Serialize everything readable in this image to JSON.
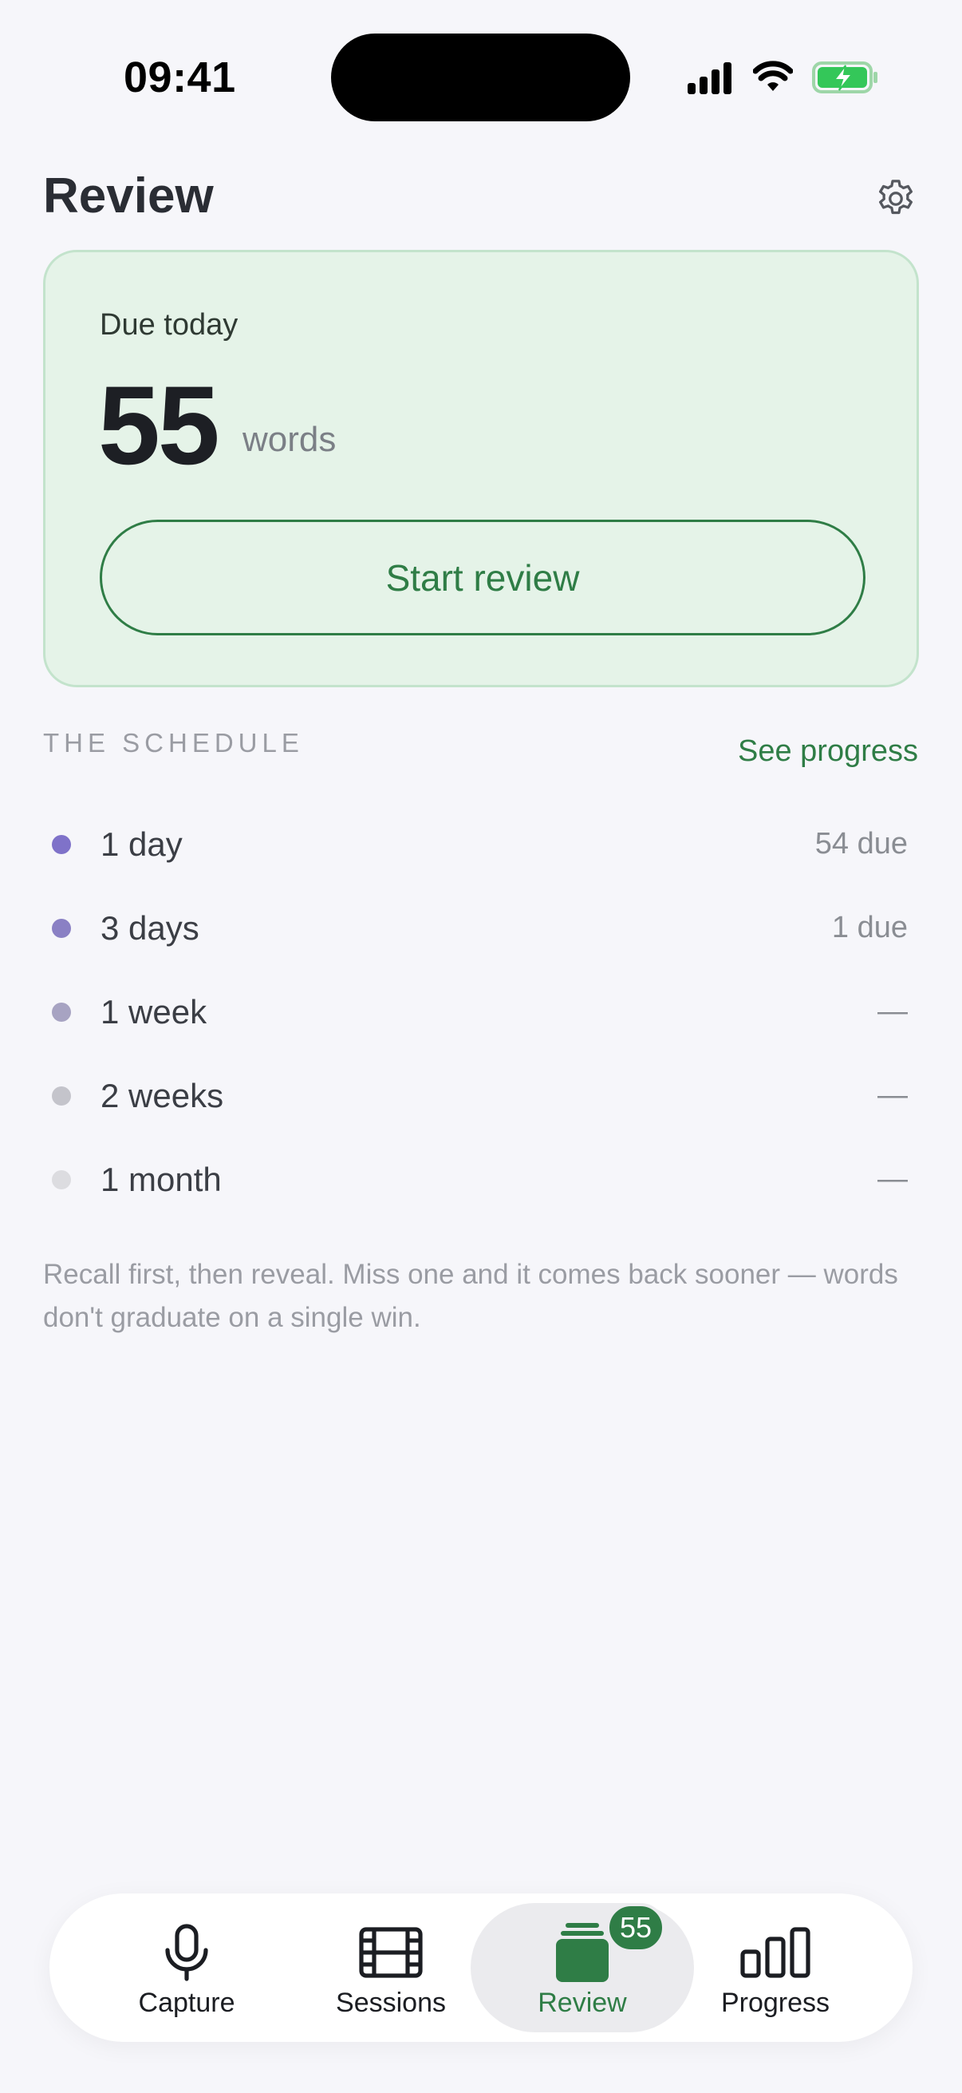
{
  "status_bar": {
    "time": "09:41"
  },
  "header": {
    "title": "Review"
  },
  "due_card": {
    "label": "Due today",
    "count": "55",
    "unit": "words",
    "button_label": "Start review"
  },
  "schedule": {
    "section_label": "THE SCHEDULE",
    "link_label": "See progress",
    "rows": [
      {
        "label": "1 day",
        "value": "54 due",
        "dot_color": "#7f72c9"
      },
      {
        "label": "3 days",
        "value": "1 due",
        "dot_color": "#8a80c4"
      },
      {
        "label": "1 week",
        "value": "—",
        "dot_color": "#a7a3c2"
      },
      {
        "label": "2 weeks",
        "value": "—",
        "dot_color": "#c4c4cb"
      },
      {
        "label": "1 month",
        "value": "—",
        "dot_color": "#dcdce0"
      }
    ]
  },
  "hint": "Recall first, then reveal. Miss one and it comes back sooner — words don't graduate on a single win.",
  "tabbar": {
    "tabs": [
      {
        "label": "Capture",
        "icon": "microphone-icon"
      },
      {
        "label": "Sessions",
        "icon": "film-icon"
      },
      {
        "label": "Review",
        "icon": "cards-stack-icon",
        "badge": "55",
        "active": true
      },
      {
        "label": "Progress",
        "icon": "bar-chart-icon"
      }
    ]
  },
  "colors": {
    "accent": "#2f7d46",
    "card_bg": "#e5f3e8",
    "page_bg": "#f6f6fa"
  }
}
